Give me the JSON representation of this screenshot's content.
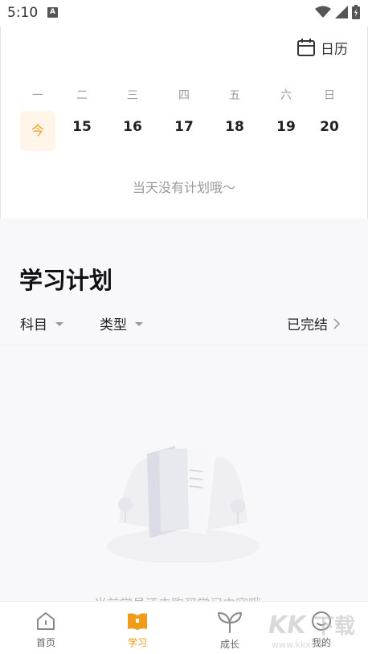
{
  "status_bar": {
    "time": "5:10",
    "notification_glyph": "A"
  },
  "header": {
    "calendar_label": "日历"
  },
  "week": {
    "days": [
      "一",
      "二",
      "三",
      "四",
      "五",
      "六",
      "日"
    ],
    "dates": [
      "今",
      "15",
      "16",
      "17",
      "18",
      "19",
      "20"
    ]
  },
  "day_plan": {
    "empty_text": "当天没有计划哦～"
  },
  "study_plan": {
    "title": "学习计划",
    "filter_subject": "科目",
    "filter_type": "类型",
    "completed_label": "已完结",
    "empty_text": "当前学员还未购买学习内容哦～"
  },
  "bottom_nav": {
    "items": [
      {
        "label": "首页",
        "icon": "home-icon"
      },
      {
        "label": "学习",
        "icon": "study-book-icon"
      },
      {
        "label": "成长",
        "icon": "sprout-icon"
      },
      {
        "label": "我的",
        "icon": "profile-icon"
      }
    ]
  },
  "colors": {
    "accent": "#f09b1a",
    "today_bg": "#fff5e8",
    "band": "#f8f8fa"
  }
}
